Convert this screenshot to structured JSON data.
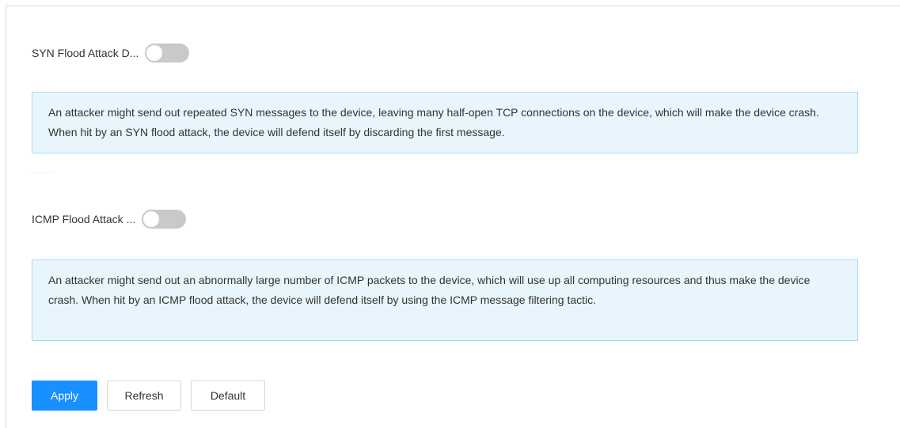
{
  "syn": {
    "label": "SYN Flood Attack D...",
    "enabled": false,
    "description": "An attacker might send out repeated SYN messages to the device, leaving many half-open TCP connections on the device, which will make the device crash. When hit by an SYN flood attack, the device will defend itself by discarding the first message."
  },
  "icmp": {
    "label": "ICMP Flood Attack ...",
    "enabled": false,
    "description": "An attacker might send out an abnormally large number of ICMP packets to the device, which will use up all computing resources and thus make the device crash. When hit by an ICMP flood attack, the device will defend itself by using the ICMP message filtering tactic."
  },
  "buttons": {
    "apply": "Apply",
    "refresh": "Refresh",
    "default": "Default"
  },
  "colors": {
    "primary": "#1890ff",
    "toggle_off": "#c9c9c9",
    "info_bg": "#e8f5fc",
    "info_border": "#a9dbf5"
  }
}
